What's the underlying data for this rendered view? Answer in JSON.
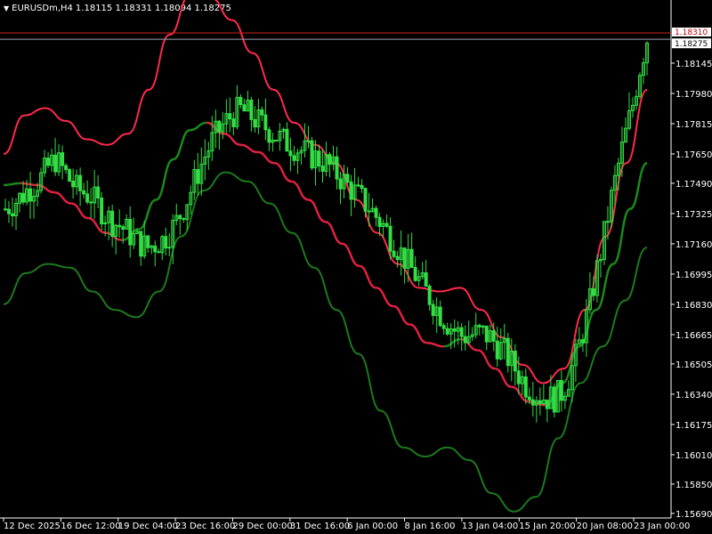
{
  "header": {
    "symbol_timeframe": "EURUSDm,H4",
    "ohlc": "1.18115 1.18331 1.18094 1.18275",
    "menu_icon": "triangle-down-icon"
  },
  "colors": {
    "background": "#000000",
    "axis": "#ffffff",
    "candle": "#33dd44",
    "middle_band_down": "#e02040",
    "middle_band_up": "#1a8a1a",
    "upper_band": "#ff2a4a",
    "lower_band": "#1c7a1c",
    "bid_line": "#d02020",
    "ask_line": "#9aa0b0"
  },
  "chart_data": {
    "type": "candlestick",
    "symbol": "EURUSDm",
    "timeframe": "H4",
    "ylim": [
      1.15665,
      1.1847
    ],
    "y_ticks": [
      "1.18145",
      "1.17980",
      "1.17815",
      "1.17650",
      "1.17490",
      "1.17325",
      "1.17160",
      "1.16995",
      "1.16830",
      "1.16665",
      "1.16505",
      "1.16340",
      "1.16175",
      "1.16010",
      "1.15850",
      "1.15690"
    ],
    "x_ticks": [
      "12 Dec 2025",
      "16 Dec 12:00",
      "19 Dec 04:00",
      "23 Dec 16:00",
      "29 Dec 00:00",
      "31 Dec 16:00",
      "6 Jan 00:00",
      "8 Jan 16:00",
      "13 Jan 04:00",
      "15 Jan 20:00",
      "20 Jan 08:00",
      "23 Jan 00:00"
    ],
    "current_price": "1.18275",
    "bid_level": "1.18310",
    "closes": [
      1.1735,
      1.1738,
      1.1741,
      1.1745,
      1.1748,
      1.1752,
      1.1758,
      1.1762,
      1.1757,
      1.1751,
      1.1746,
      1.1744,
      1.1742,
      1.1737,
      1.1732,
      1.1728,
      1.1726,
      1.1723,
      1.1719,
      1.1716,
      1.1714,
      1.1716,
      1.1718,
      1.1722,
      1.1728,
      1.1736,
      1.1745,
      1.1755,
      1.1764,
      1.1772,
      1.1778,
      1.1783,
      1.1787,
      1.1789,
      1.1787,
      1.1784,
      1.1781,
      1.1778,
      1.1775,
      1.1772,
      1.177,
      1.1768,
      1.1766,
      1.1764,
      1.1762,
      1.176,
      1.1756,
      1.1752,
      1.1748,
      1.1744,
      1.174,
      1.1736,
      1.1731,
      1.1726,
      1.172,
      1.1714,
      1.1708,
      1.1702,
      1.1696,
      1.169,
      1.1684,
      1.1678,
      1.1673,
      1.1669,
      1.1666,
      1.1666,
      1.1667,
      1.1667,
      1.1665,
      1.1661,
      1.1657,
      1.1651,
      1.1645,
      1.1639,
      1.1636,
      1.1633,
      1.1632,
      1.1632,
      1.1635,
      1.1643,
      1.1654,
      1.1668,
      1.1684,
      1.1702,
      1.1721,
      1.1741,
      1.1759,
      1.1776,
      1.1792,
      1.1812,
      1.1828
    ],
    "middle_band": [
      1.1748,
      1.1749,
      1.1748,
      1.1744,
      1.1738,
      1.173,
      1.1722,
      1.1718,
      1.1724,
      1.174,
      1.1762,
      1.1778,
      1.1782,
      1.1776,
      1.177,
      1.1766,
      1.176,
      1.175,
      1.174,
      1.1728,
      1.1716,
      1.1704,
      1.1692,
      1.1682,
      1.1672,
      1.1662,
      1.166,
      1.1664,
      1.1658,
      1.1648,
      1.1638,
      1.163,
      1.1628,
      1.164,
      1.166,
      1.168,
      1.1705,
      1.1735,
      1.176
    ],
    "upper_band": [
      1.1765,
      1.1786,
      1.179,
      1.1783,
      1.1773,
      1.177,
      1.1776,
      1.18,
      1.183,
      1.1852,
      1.185,
      1.1838,
      1.182,
      1.18,
      1.1782,
      1.177,
      1.176,
      1.174,
      1.1722,
      1.1705,
      1.1692,
      1.169,
      1.1692,
      1.168,
      1.1665,
      1.165,
      1.164,
      1.1648,
      1.168,
      1.172,
      1.176,
      1.18
    ],
    "lower_band": [
      1.1683,
      1.17,
      1.1705,
      1.1703,
      1.169,
      1.168,
      1.1676,
      1.169,
      1.172,
      1.1745,
      1.1755,
      1.175,
      1.1738,
      1.1722,
      1.1703,
      1.168,
      1.1656,
      1.1625,
      1.1605,
      1.16,
      1.1605,
      1.1598,
      1.158,
      1.157,
      1.1578,
      1.161,
      1.164,
      1.166,
      1.1685,
      1.1714
    ]
  }
}
